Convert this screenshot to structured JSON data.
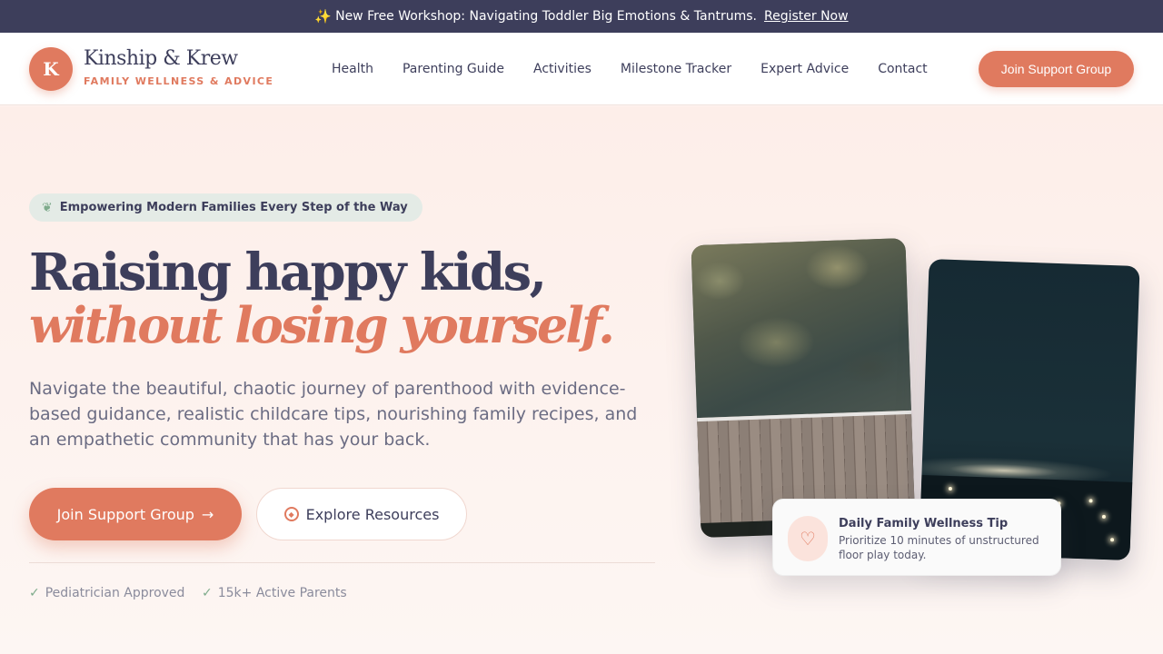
{
  "announcement": {
    "icon": "sparkles-icon",
    "text": "New Free Workshop: Navigating Toddler Big Emotions & Tantrums.",
    "link_label": "Register Now"
  },
  "brand": {
    "logo_letter": "K",
    "name": "Kinship & Krew",
    "tagline": "FAMILY WELLNESS & ADVICE"
  },
  "nav": {
    "items": [
      {
        "label": "Health"
      },
      {
        "label": "Parenting Guide"
      },
      {
        "label": "Activities"
      },
      {
        "label": "Milestone Tracker"
      },
      {
        "label": "Expert Advice"
      },
      {
        "label": "Contact"
      }
    ],
    "cta_label": "Join Support Group"
  },
  "hero": {
    "pill_icon": "sprout-icon",
    "pill_text": "Empowering Modern Families Every Step of the Way",
    "headline_line1": "Raising happy kids,",
    "headline_line2": "without losing yourself.",
    "lead": "Navigate the beautiful, chaotic journey of parenthood with evidence-based guidance, realistic childcare tips, nourishing family recipes, and an empathetic community that has your back.",
    "primary_cta": "Join Support Group",
    "secondary_cta": "Explore Resources",
    "trust_badges": [
      {
        "label": "Pediatrician Approved"
      },
      {
        "label": "15k+ Active Parents"
      }
    ]
  },
  "tip_card": {
    "icon": "heart-pulse-icon",
    "title": "Daily Family Wellness Tip",
    "text": "Prioritize 10 minutes of unstructured floor play today."
  },
  "colors": {
    "accent": "#e07a5f",
    "navy": "#3d3e5b",
    "sage": "#7fab8c"
  }
}
